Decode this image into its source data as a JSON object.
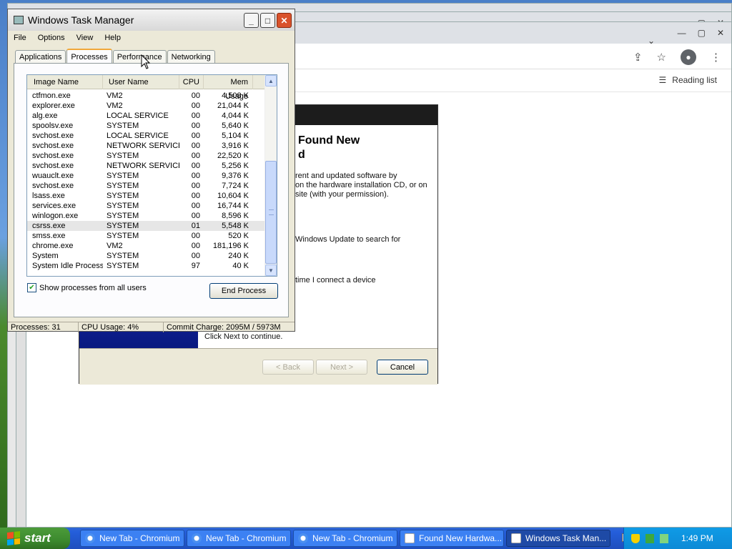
{
  "chromium": {
    "reading_list": "Reading list",
    "icons": [
      "share-icon",
      "star-icon",
      "profile-icon",
      "menu-icon"
    ]
  },
  "wizard": {
    "heading_line1": "Found New",
    "heading_line2": "d",
    "para1_l1": "rent and updated software by",
    "para1_l2": "on the hardware installation CD, or on",
    "para1_l3": "site (with your permission).",
    "para2": "Windows Update to search for",
    "para3": "time I connect a device",
    "click_next": "Click Next to continue.",
    "back_label": "< Back",
    "next_label": "Next >",
    "cancel_label": "Cancel"
  },
  "taskmgr": {
    "title": "Windows Task Manager",
    "menu": [
      "File",
      "Options",
      "View",
      "Help"
    ],
    "tabs": [
      "Applications",
      "Processes",
      "Performance",
      "Networking"
    ],
    "active_tab": "Processes",
    "columns": [
      "Image Name",
      "User Name",
      "CPU",
      "Mem Usage"
    ],
    "processes": [
      {
        "name": "ctfmon.exe",
        "user": "VM2",
        "cpu": "00",
        "mem": "4,508 K"
      },
      {
        "name": "explorer.exe",
        "user": "VM2",
        "cpu": "00",
        "mem": "21,044 K"
      },
      {
        "name": "alg.exe",
        "user": "LOCAL SERVICE",
        "cpu": "00",
        "mem": "4,044 K"
      },
      {
        "name": "spoolsv.exe",
        "user": "SYSTEM",
        "cpu": "00",
        "mem": "5,640 K"
      },
      {
        "name": "svchost.exe",
        "user": "LOCAL SERVICE",
        "cpu": "00",
        "mem": "5,104 K"
      },
      {
        "name": "svchost.exe",
        "user": "NETWORK SERVICE",
        "cpu": "00",
        "mem": "3,916 K"
      },
      {
        "name": "svchost.exe",
        "user": "SYSTEM",
        "cpu": "00",
        "mem": "22,520 K"
      },
      {
        "name": "svchost.exe",
        "user": "NETWORK SERVICE",
        "cpu": "00",
        "mem": "5,256 K"
      },
      {
        "name": "wuauclt.exe",
        "user": "SYSTEM",
        "cpu": "00",
        "mem": "9,376 K"
      },
      {
        "name": "svchost.exe",
        "user": "SYSTEM",
        "cpu": "00",
        "mem": "7,724 K"
      },
      {
        "name": "lsass.exe",
        "user": "SYSTEM",
        "cpu": "00",
        "mem": "10,604 K"
      },
      {
        "name": "services.exe",
        "user": "SYSTEM",
        "cpu": "00",
        "mem": "16,744 K"
      },
      {
        "name": "winlogon.exe",
        "user": "SYSTEM",
        "cpu": "00",
        "mem": "8,596 K"
      },
      {
        "name": "csrss.exe",
        "user": "SYSTEM",
        "cpu": "01",
        "mem": "5,548 K",
        "selected": true
      },
      {
        "name": "smss.exe",
        "user": "SYSTEM",
        "cpu": "00",
        "mem": "520 K"
      },
      {
        "name": "chrome.exe",
        "user": "VM2",
        "cpu": "00",
        "mem": "181,196 K"
      },
      {
        "name": "System",
        "user": "SYSTEM",
        "cpu": "00",
        "mem": "240 K"
      },
      {
        "name": "System Idle Process",
        "user": "SYSTEM",
        "cpu": "97",
        "mem": "40 K"
      }
    ],
    "show_all_label": "Show processes from all users",
    "show_all_checked": true,
    "end_process_label": "End Process",
    "status": {
      "processes": "Processes: 31",
      "cpu": "CPU Usage: 4%",
      "commit": "Commit Charge: 2095M / 5973M"
    }
  },
  "taskbar": {
    "start_label": "start",
    "tasks": [
      {
        "label": "New Tab - Chromium",
        "icon": "chromium-icon"
      },
      {
        "label": "New Tab - Chromium",
        "icon": "chromium-icon"
      },
      {
        "label": "New Tab - Chromium",
        "icon": "chromium-icon"
      },
      {
        "label": "Found New Hardwa...",
        "icon": "wizard-icon"
      },
      {
        "label": "Windows Task Man...",
        "icon": "taskmgr-icon",
        "active": true
      }
    ],
    "clock": "1:49 PM"
  },
  "colors": {
    "xp_blue": "#245edb",
    "start_green": "#3c8a2e",
    "tray_blue": "#0f9be6",
    "selected_row": "#e6e6e6"
  }
}
